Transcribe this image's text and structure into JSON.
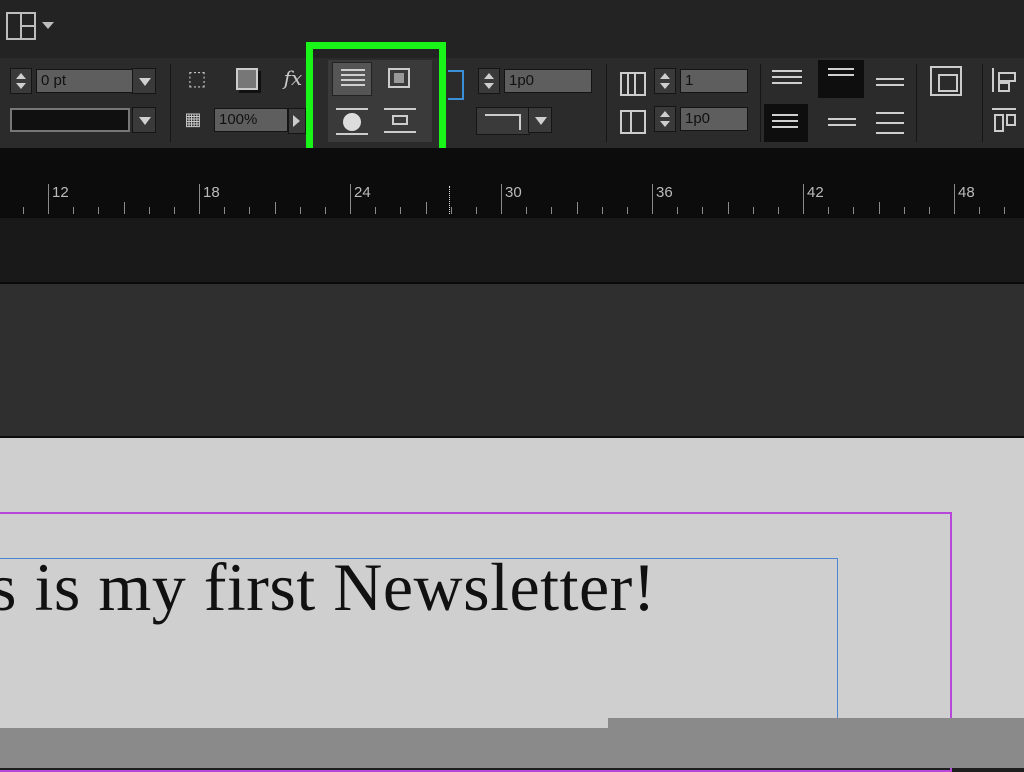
{
  "control_panel": {
    "stroke_weight": "0 pt",
    "opacity": "100%",
    "fx_label": "fx",
    "offset_value": "1p0",
    "columns_value": "1",
    "gutter_value": "1p0"
  },
  "ruler": {
    "labels": [
      "12",
      "18",
      "24",
      "30",
      "36",
      "42",
      "48"
    ]
  },
  "document": {
    "headline": "s is my first Newsletter!"
  },
  "colors": {
    "highlight": "#19f519",
    "margin_guide": "#b548d8",
    "frame_edge": "#4f84d2"
  }
}
